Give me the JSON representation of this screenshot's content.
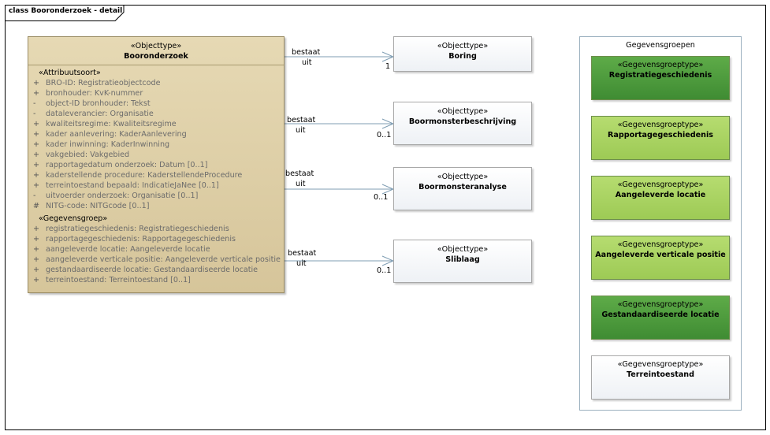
{
  "frame": {
    "title": "class Booronderzoek - detail"
  },
  "main_class": {
    "stereotype": "«Objecttype»",
    "name": "Booronderzoek",
    "attr_section": "«Attribuutsoort»",
    "attributes": [
      {
        "vis": "+",
        "text": "BRO-ID: Registratieobjectcode"
      },
      {
        "vis": "+",
        "text": "bronhouder: KvK-nummer"
      },
      {
        "vis": "-",
        "text": "object-ID bronhouder: Tekst"
      },
      {
        "vis": "-",
        "text": "dataleverancier: Organisatie"
      },
      {
        "vis": "+",
        "text": "kwaliteitsregime: Kwaliteitsregime"
      },
      {
        "vis": "+",
        "text": "kader aanlevering: KaderAanlevering"
      },
      {
        "vis": "+",
        "text": "kader inwinning: KaderInwinning"
      },
      {
        "vis": "+",
        "text": "vakgebied: Vakgebied"
      },
      {
        "vis": "+",
        "text": "rapportagedatum onderzoek: Datum [0..1]"
      },
      {
        "vis": "+",
        "text": "kaderstellende procedure: KaderstellendeProcedure"
      },
      {
        "vis": "+",
        "text": "terreintoestand bepaald: IndicatieJaNee [0..1]"
      },
      {
        "vis": "-",
        "text": "uitvoerder onderzoek: Organisatie [0..1]"
      },
      {
        "vis": "#",
        "text": "NITG-code: NITGcode [0..1]"
      }
    ],
    "group_section": "«Gegevensgroep»",
    "groups": [
      {
        "vis": "+",
        "text": "registratiegeschiedenis: Registratiegeschiedenis"
      },
      {
        "vis": "+",
        "text": "rapportagegeschiedenis: Rapportagegeschiedenis"
      },
      {
        "vis": "+",
        "text": "aangeleverde locatie: Aangeleverde locatie"
      },
      {
        "vis": "+",
        "text": "aangeleverde verticale positie: Aangeleverde verticale positie"
      },
      {
        "vis": "+",
        "text": "gestandaardiseerde locatie: Gestandaardiseerde locatie"
      },
      {
        "vis": "+",
        "text": "terreintoestand: Terreintoestand [0..1]"
      }
    ]
  },
  "objects": [
    {
      "stereotype": "«Objecttype»",
      "name": "Boring",
      "role1": "bestaat",
      "role2": "uit",
      "mult": "1"
    },
    {
      "stereotype": "«Objecttype»",
      "name": "Boormonsterbeschrijving",
      "role1": "bestaat",
      "role2": "uit",
      "mult": "0..1"
    },
    {
      "stereotype": "«Objecttype»",
      "name": "Boormonsteranalyse",
      "role1": "bestaat",
      "role2": "uit",
      "mult": "0..1"
    },
    {
      "stereotype": "«Objecttype»",
      "name": "Sliblaag",
      "role1": "bestaat",
      "role2": "uit",
      "mult": "0..1"
    }
  ],
  "group_container": {
    "title": "Gegevensgroepen",
    "items": [
      {
        "stereotype": "«Gegevensgroeptype»",
        "name": "Registratiegeschiedenis",
        "fill": "#4f9e3e"
      },
      {
        "stereotype": "«Gegevensgroeptype»",
        "name": "Rapportagegeschiedenis",
        "fill": "#a9d362"
      },
      {
        "stereotype": "«Gegevensgroeptype»",
        "name": "Aangeleverde locatie",
        "fill": "#a9d362"
      },
      {
        "stereotype": "«Gegevensgroeptype»",
        "name": "Aangeleverde verticale positie",
        "fill": "#a9d362"
      },
      {
        "stereotype": "«Gegevensgroeptype»",
        "name": "Gestandaardiseerde locatie",
        "fill": "#4f9e3e"
      },
      {
        "stereotype": "«Gegevensgroeptype»",
        "name": "Terreintoestand",
        "fill": "#ffffff"
      }
    ]
  }
}
